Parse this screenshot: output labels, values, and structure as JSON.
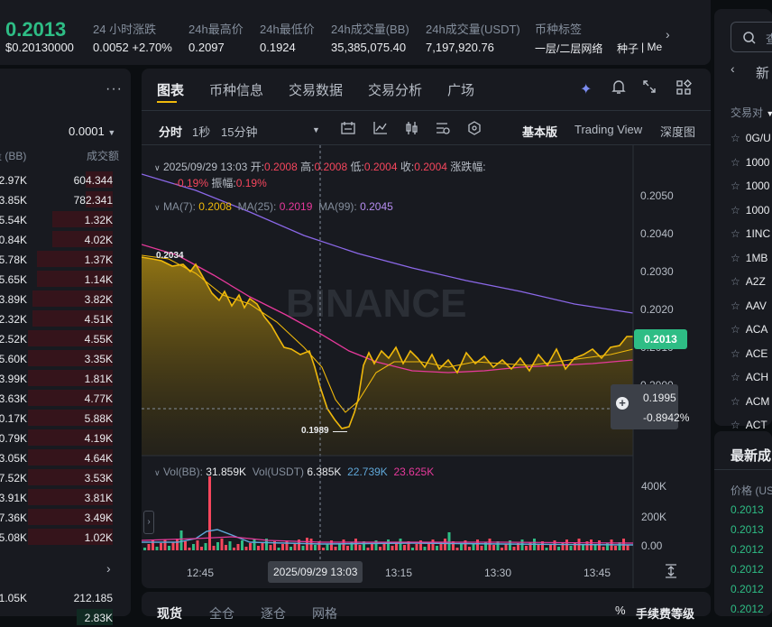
{
  "header": {
    "price": "0.2013",
    "price_usd": "$0.20130000",
    "stats": [
      {
        "label": "24 小时涨跌",
        "value": "0.0052 +2.70%"
      },
      {
        "label": "24h最高价",
        "value": "0.2097"
      },
      {
        "label": "24h最低价",
        "value": "0.1924"
      },
      {
        "label": "24h成交量(BB)",
        "value": "35,385,075.40"
      },
      {
        "label": "24h成交量(USDT)",
        "value": "7,197,920.76"
      },
      {
        "label": "币种标签",
        "value": "一层/二层网络"
      },
      {
        "label": "",
        "value": "种子"
      },
      {
        "label": "",
        "value": "| Me"
      }
    ],
    "expand_icon": "chevron-right"
  },
  "orderbook": {
    "menu_icon": "more-dots",
    "precision": "0.0001",
    "col_amount": "量 (BB)",
    "col_total": "成交额",
    "asks": [
      {
        "amount": "2.97K",
        "total": "604.344",
        "depth": 0.22
      },
      {
        "amount": "3.85K",
        "total": "782.341",
        "depth": 0.22
      },
      {
        "amount": "5.54K",
        "total": "1.32K",
        "depth": 0.5
      },
      {
        "amount": "0.84K",
        "total": "4.02K",
        "depth": 0.5
      },
      {
        "amount": "5.78K",
        "total": "1.37K",
        "depth": 0.62
      },
      {
        "amount": "5.65K",
        "total": "1.14K",
        "depth": 0.62
      },
      {
        "amount": "3.89K",
        "total": "3.82K",
        "depth": 0.66
      },
      {
        "amount": "2.32K",
        "total": "4.51K",
        "depth": 0.66
      },
      {
        "amount": "2.52K",
        "total": "4.55K",
        "depth": 0.7
      },
      {
        "amount": "5.60K",
        "total": "3.35K",
        "depth": 0.7
      },
      {
        "amount": "3.99K",
        "total": "1.81K",
        "depth": 0.7
      },
      {
        "amount": "3.63K",
        "total": "4.77K",
        "depth": 0.7
      },
      {
        "amount": "0.17K",
        "total": "5.88K",
        "depth": 0.7
      },
      {
        "amount": "0.79K",
        "total": "4.19K",
        "depth": 0.7
      },
      {
        "amount": "3.05K",
        "total": "4.64K",
        "depth": 0.7
      },
      {
        "amount": "7.52K",
        "total": "3.53K",
        "depth": 0.7
      },
      {
        "amount": "3.91K",
        "total": "3.81K",
        "depth": 0.7
      },
      {
        "amount": "7.36K",
        "total": "3.49K",
        "depth": 0.7
      },
      {
        "amount": "5.08K",
        "total": "1.02K",
        "depth": 0.7
      }
    ],
    "bottom_row": {
      "amount": "1.05K",
      "total": "212.185"
    },
    "bottom_row2": {
      "amount": "",
      "total": "2.83K"
    }
  },
  "chart": {
    "tabs": [
      "图表",
      "币种信息",
      "交易数据",
      "交易分析",
      "广场"
    ],
    "intervals": [
      "分时",
      "1秒",
      "15分钟"
    ],
    "views": [
      "基本版",
      "Trading View",
      "深度图"
    ],
    "ohlc": {
      "date": "2025/09/29 13:03",
      "open_label": "开:",
      "open": "0.2008",
      "high_label": "高:",
      "high": "0.2008",
      "low_label": "低:",
      "low": "0.2004",
      "close_label": "收:",
      "close": "0.2004",
      "change_label": "涨跌幅:",
      "change": "-0.19%",
      "amp_label": "振幅:",
      "amp": "0.19%"
    },
    "ma": [
      {
        "label": "MA(7):",
        "value": "0.2008",
        "color": "#f0b90b"
      },
      {
        "label": "MA(25):",
        "value": "0.2019",
        "color": "#e6399b"
      },
      {
        "label": "MA(99):",
        "value": "0.2045",
        "color": "#8b68e8"
      }
    ],
    "watermark": "BINANCE",
    "y_ticks": [
      "0.2050",
      "0.2040",
      "0.2030",
      "0.2020",
      "0.2010",
      "0.2000"
    ],
    "price_tag": "0.2013",
    "cursor_price": "0.1995",
    "cursor_pct": "-0.8942%",
    "high_marker": "0.2034",
    "low_marker": "0.1989",
    "vol": {
      "label": "Vol(BB):",
      "value": "31.859K",
      "label2": "Vol(USDT)",
      "value2": "6.385K",
      "value3": "22.739K",
      "value4": "23.625K"
    },
    "vol_ticks": [
      "400K",
      "200K",
      "0.00"
    ],
    "x_ticks": [
      "12:45",
      "13:15",
      "13:30",
      "13:45"
    ],
    "x_cursor": "2025/09/29 13:03"
  },
  "right": {
    "search_icon": "search",
    "tab_label": "新",
    "pair_header": "交易对",
    "symbols": [
      "0G/U",
      "1000",
      "1000",
      "1000",
      "1INC",
      "1MB",
      "A2Z",
      "AAV",
      "ACA",
      "ACE",
      "ACH",
      "ACM",
      "ACT"
    ]
  },
  "trades": {
    "title": "最新成",
    "col_price": "价格 (US",
    "prices": [
      "0.2013",
      "0.2013",
      "0.2012",
      "0.2012",
      "0.2012",
      "0.2012"
    ]
  },
  "bottom": {
    "tabs": [
      "现货",
      "全仓",
      "逐仓",
      "网格"
    ],
    "fee_label": "手续费等级",
    "pct_icon": "%"
  }
}
